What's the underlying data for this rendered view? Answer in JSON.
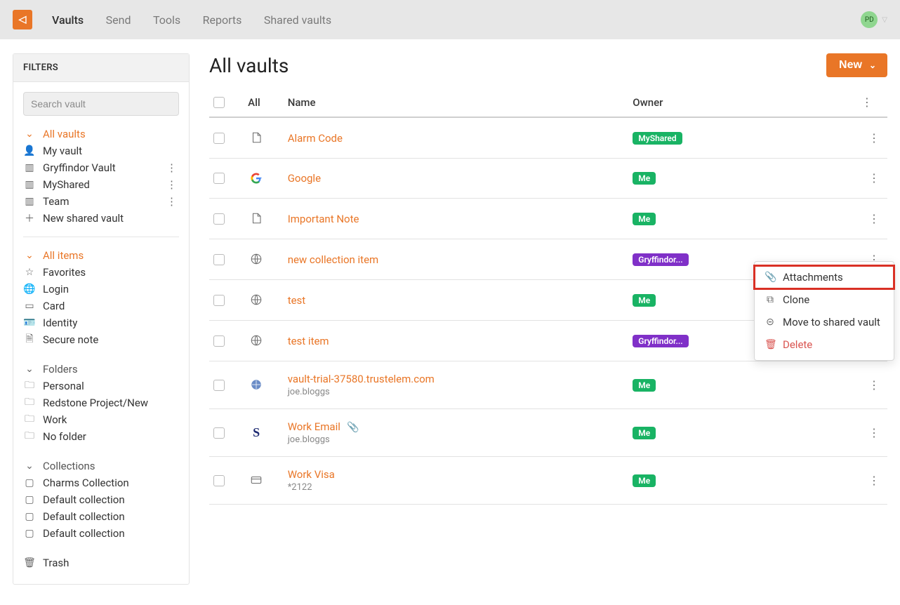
{
  "nav": {
    "items": [
      "Vaults",
      "Send",
      "Tools",
      "Reports",
      "Shared vaults"
    ],
    "active": 0,
    "avatar_initials": "PD"
  },
  "sidebar": {
    "title": "FILTERS",
    "search_placeholder": "Search vault",
    "vaults": {
      "head": "All vaults",
      "items": [
        {
          "icon": "person-icon",
          "label": "My vault",
          "kebab": false
        },
        {
          "icon": "vault-icon",
          "label": "Gryffindor Vault",
          "kebab": true
        },
        {
          "icon": "vault-icon",
          "label": "MyShared",
          "kebab": true
        },
        {
          "icon": "vault-icon",
          "label": "Team",
          "kebab": true
        },
        {
          "icon": "plus-icon",
          "label": "New shared vault",
          "kebab": false
        }
      ]
    },
    "types": {
      "head": "All items",
      "items": [
        {
          "icon": "star-icon",
          "label": "Favorites"
        },
        {
          "icon": "globe-icon",
          "label": "Login"
        },
        {
          "icon": "card-icon",
          "label": "Card"
        },
        {
          "icon": "id-icon",
          "label": "Identity"
        },
        {
          "icon": "note-icon",
          "label": "Secure note"
        }
      ]
    },
    "folders": {
      "head": "Folders",
      "items": [
        {
          "label": "Personal"
        },
        {
          "label": "Redstone Project/New"
        },
        {
          "label": "Work"
        },
        {
          "label": "No folder"
        }
      ]
    },
    "collections": {
      "head": "Collections",
      "items": [
        {
          "label": "Charms Collection"
        },
        {
          "label": "Default collection"
        },
        {
          "label": "Default collection"
        },
        {
          "label": "Default collection"
        }
      ]
    },
    "trash_label": "Trash"
  },
  "main": {
    "title": "All vaults",
    "new_label": "New",
    "columns": {
      "all": "All",
      "name": "Name",
      "owner": "Owner"
    },
    "items": [
      {
        "icon": "note",
        "name": "Alarm Code",
        "sub": "",
        "owner": "MyShared",
        "owner_color": "green",
        "attach": false
      },
      {
        "icon": "google",
        "name": "Google",
        "sub": "",
        "owner": "Me",
        "owner_color": "green",
        "attach": false
      },
      {
        "icon": "note",
        "name": "Important Note",
        "sub": "",
        "owner": "Me",
        "owner_color": "green",
        "attach": false
      },
      {
        "icon": "globe",
        "name": "new collection item",
        "sub": "",
        "owner": "Gryffindor...",
        "owner_color": "purple",
        "attach": false
      },
      {
        "icon": "globe",
        "name": "test",
        "sub": "",
        "owner": "Me",
        "owner_color": "green",
        "attach": false
      },
      {
        "icon": "globe",
        "name": "test item",
        "sub": "",
        "owner": "Gryffindor...",
        "owner_color": "purple",
        "attach": false
      },
      {
        "icon": "globe-filled",
        "name": "vault-trial-37580.trustelem.com",
        "sub": "joe.bloggs",
        "owner": "Me",
        "owner_color": "green",
        "attach": false
      },
      {
        "icon": "s-mark",
        "name": "Work Email",
        "sub": "joe.bloggs",
        "owner": "Me",
        "owner_color": "green",
        "attach": true
      },
      {
        "icon": "card",
        "name": "Work Visa",
        "sub": "*2122",
        "owner": "Me",
        "owner_color": "green",
        "attach": false
      }
    ],
    "context_menu": {
      "items": [
        {
          "icon": "paperclip-icon",
          "label": "Attachments",
          "highlight": true
        },
        {
          "icon": "clone-icon",
          "label": "Clone"
        },
        {
          "icon": "move-icon",
          "label": "Move to shared vault"
        },
        {
          "icon": "trash-icon",
          "label": "Delete",
          "danger": true
        }
      ]
    }
  }
}
